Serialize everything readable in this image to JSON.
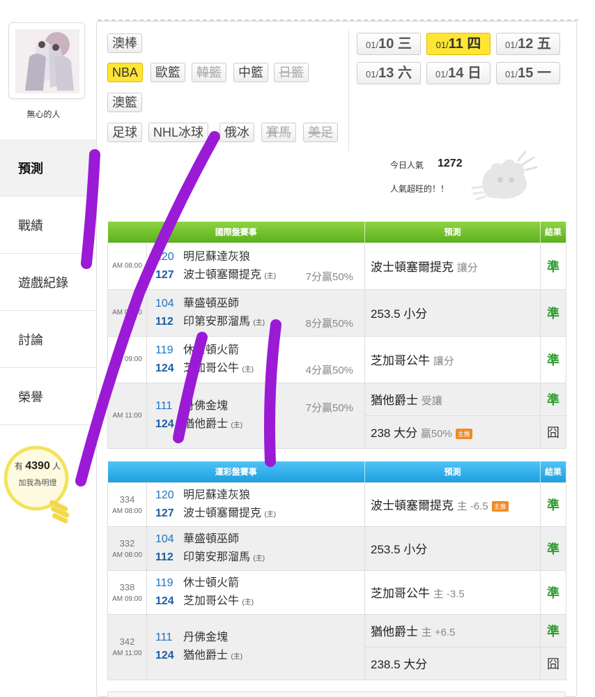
{
  "sidebar": {
    "username": "無心的人",
    "menu": [
      "預測",
      "戰績",
      "遊戲紀錄",
      "討論",
      "榮譽"
    ],
    "fans": {
      "prefix": "有",
      "count": "4390",
      "suffix": "人",
      "label": "加我為明燈"
    }
  },
  "sports": [
    {
      "label": "澳棒",
      "state": "normal"
    },
    {
      "label": "NBA",
      "state": "active"
    },
    {
      "label": "歐籃",
      "state": "normal"
    },
    {
      "label": "韓籃",
      "state": "disabled"
    },
    {
      "label": "中籃",
      "state": "normal"
    },
    {
      "label": "日籃",
      "state": "disabled"
    },
    {
      "label": "澳籃",
      "state": "normal"
    },
    {
      "label": "足球",
      "state": "normal"
    },
    {
      "label": "NHL冰球",
      "state": "normal"
    },
    {
      "label": "俄冰",
      "state": "normal"
    },
    {
      "label": "賽馬",
      "state": "disabled"
    },
    {
      "label": "美足",
      "state": "disabled"
    }
  ],
  "dates": [
    {
      "month": "01/",
      "day": "10",
      "weekday": "三",
      "active": false
    },
    {
      "month": "01/",
      "day": "11",
      "weekday": "四",
      "active": true
    },
    {
      "month": "01/",
      "day": "12",
      "weekday": "五",
      "active": false
    },
    {
      "month": "01/",
      "day": "13",
      "weekday": "六",
      "active": false
    },
    {
      "month": "01/",
      "day": "14",
      "weekday": "日",
      "active": false
    },
    {
      "month": "01/",
      "day": "15",
      "weekday": "一",
      "active": false
    }
  ],
  "popularity": {
    "label": "今日人氣",
    "value": "1272",
    "note": "人氣超旺的！！"
  },
  "intl_table": {
    "headers": [
      "國際盤賽事",
      "預測",
      "結果"
    ],
    "games": [
      {
        "time": "AM 08:00",
        "away_no": "120",
        "away": "明尼蘇達灰狼",
        "home_no": "127",
        "home": "波士頓塞爾提克",
        "rate": "7分贏50%",
        "preds": [
          {
            "text": "波士頓塞爾提克",
            "extra": "讓分",
            "badge": "",
            "result": "準"
          }
        ]
      },
      {
        "time": "AM 08:00",
        "away_no": "104",
        "away": "華盛頓巫師",
        "home_no": "112",
        "home": "印第安那溜馬",
        "rate": "8分贏50%",
        "preds": [
          {
            "text": "253.5 小分",
            "extra": "",
            "badge": "",
            "result": "準"
          }
        ]
      },
      {
        "time": "AM 09:00",
        "away_no": "119",
        "away": "休士頓火箭",
        "home_no": "124",
        "home": "芝加哥公牛",
        "rate": "4分贏50%",
        "preds": [
          {
            "text": "芝加哥公牛",
            "extra": "讓分",
            "badge": "",
            "result": "準"
          }
        ]
      },
      {
        "time": "AM 11:00",
        "away_no": "111",
        "away": "丹佛金塊",
        "home_no": "124",
        "home": "猶他爵士",
        "rate": "7分贏50%",
        "preds": [
          {
            "text": "猶他爵士",
            "extra": "受讓",
            "badge": "",
            "result": "準"
          },
          {
            "text": "238 大分",
            "extra": "贏50%",
            "badge": "主推",
            "result": "囧"
          }
        ]
      }
    ]
  },
  "lottery_table": {
    "headers": [
      "運彩盤賽事",
      "預測",
      "結果"
    ],
    "games": [
      {
        "no": "334",
        "time": "AM 08:00",
        "away_no": "120",
        "away": "明尼蘇達灰狼",
        "home_no": "127",
        "home": "波士頓塞爾提克",
        "preds": [
          {
            "text": "波士頓塞爾提克",
            "extra": "主 -6.5",
            "badge": "主推",
            "result": "準"
          }
        ]
      },
      {
        "no": "332",
        "time": "AM 08:00",
        "away_no": "104",
        "away": "華盛頓巫師",
        "home_no": "112",
        "home": "印第安那溜馬",
        "preds": [
          {
            "text": "253.5 小分",
            "extra": "",
            "badge": "",
            "result": "準"
          }
        ]
      },
      {
        "no": "338",
        "time": "AM 09:00",
        "away_no": "119",
        "away": "休士頓火箭",
        "home_no": "124",
        "home": "芝加哥公牛",
        "preds": [
          {
            "text": "芝加哥公牛",
            "extra": "主 -3.5",
            "badge": "",
            "result": "準"
          }
        ]
      },
      {
        "no": "342",
        "time": "AM 11:00",
        "away_no": "111",
        "away": "丹佛金塊",
        "home_no": "124",
        "home": "猶他爵士",
        "preds": [
          {
            "text": "猶他爵士",
            "extra": "主 +6.5",
            "badge": "",
            "result": "準"
          },
          {
            "text": "238.5 大分",
            "extra": "",
            "badge": "",
            "result": "囧"
          }
        ]
      }
    ]
  },
  "home_mark": "(主)",
  "colors": {
    "accent_yellow": "#ffe633",
    "intl_header": "#6cbf2a",
    "lottery_header": "#29aae8",
    "hit_green": "#2e9e2e",
    "scribble_purple": "#9b1ad6",
    "team_blue": "#1a73c2"
  }
}
